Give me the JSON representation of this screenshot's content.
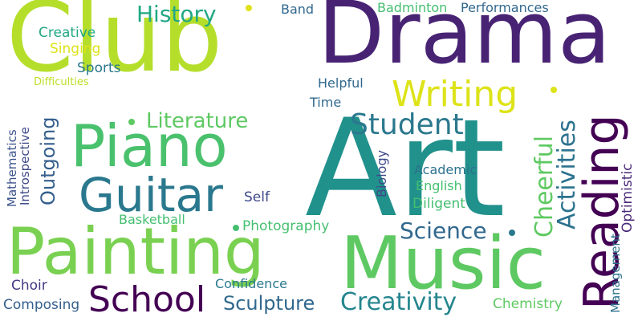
{
  "words": [
    {
      "id": "club",
      "text": "Club",
      "color": "#b5de2b"
    },
    {
      "id": "drama",
      "text": "Drama",
      "color": "#482374"
    },
    {
      "id": "art",
      "text": "Art",
      "color": "#21918c"
    },
    {
      "id": "piano",
      "text": "Piano",
      "color": "#4ac16d"
    },
    {
      "id": "guitar",
      "text": "Guitar",
      "color": "#2a788e"
    },
    {
      "id": "painting",
      "text": "Painting",
      "color": "#7ad151"
    },
    {
      "id": "music",
      "text": "Music",
      "color": "#5ec962"
    },
    {
      "id": "reading",
      "text": "Reading",
      "color": "#440154"
    },
    {
      "id": "writing",
      "text": "Writing",
      "color": "#dde318"
    },
    {
      "id": "school",
      "text": "School",
      "color": "#440154"
    },
    {
      "id": "student",
      "text": "Student",
      "color": "#2a788e"
    },
    {
      "id": "history",
      "text": "History",
      "color": "#22a884"
    },
    {
      "id": "literature",
      "text": "Literature",
      "color": "#5ec962"
    },
    {
      "id": "activities",
      "text": "Activities",
      "color": "#2c728e"
    },
    {
      "id": "cheerful",
      "text": "Cheerful",
      "color": "#5ec962"
    },
    {
      "id": "outgoing",
      "text": "Outgoing",
      "color": "#355f8d"
    },
    {
      "id": "creativity",
      "text": "Creativity",
      "color": "#25858e"
    },
    {
      "id": "science",
      "text": "Science",
      "color": "#31688e"
    },
    {
      "id": "sculpture",
      "text": "Sculpture",
      "color": "#31688e"
    },
    {
      "id": "creative",
      "text": "Creative",
      "color": "#22a884"
    },
    {
      "id": "singing",
      "text": "Singing",
      "color": "#dde318"
    },
    {
      "id": "sports",
      "text": "Sports",
      "color": "#2a788e"
    },
    {
      "id": "difficulties",
      "text": "Difficulties",
      "color": "#bddf26"
    },
    {
      "id": "band",
      "text": "Band",
      "color": "#31688e"
    },
    {
      "id": "badminton",
      "text": "Badminton",
      "color": "#44bf70"
    },
    {
      "id": "performances",
      "text": "Performances",
      "color": "#31688e"
    },
    {
      "id": "helpful",
      "text": "Helpful",
      "color": "#31688e"
    },
    {
      "id": "time",
      "text": "Time",
      "color": "#31688e"
    },
    {
      "id": "mathematics",
      "text": "Mathematics",
      "color": "#3b528b"
    },
    {
      "id": "introspective",
      "text": "Introspective",
      "color": "#3e4989"
    },
    {
      "id": "self",
      "text": "Self",
      "color": "#3e4989"
    },
    {
      "id": "biology",
      "text": "Biology",
      "color": "#3e4989"
    },
    {
      "id": "academic",
      "text": "Academic",
      "color": "#2c728e"
    },
    {
      "id": "english",
      "text": "English",
      "color": "#44bf70"
    },
    {
      "id": "diligent",
      "text": "Diligent",
      "color": "#44bf70"
    },
    {
      "id": "basketball",
      "text": "Basketball",
      "color": "#44bf70"
    },
    {
      "id": "photography",
      "text": "Photography",
      "color": "#44bf70"
    },
    {
      "id": "management",
      "text": "Management",
      "color": "#2c728e"
    },
    {
      "id": "optimistic",
      "text": "Optimistic",
      "color": "#482878"
    },
    {
      "id": "choir",
      "text": "Choir",
      "color": "#443983"
    },
    {
      "id": "composing",
      "text": "Composing",
      "color": "#355f8d"
    },
    {
      "id": "confidence",
      "text": "Confidence",
      "color": "#2a788e"
    },
    {
      "id": "chemistry",
      "text": "Chemistry",
      "color": "#5ec962"
    }
  ],
  "dots": [
    {
      "color": "#5ec962"
    },
    {
      "color": "#44bf70"
    },
    {
      "color": "#2a788e"
    },
    {
      "color": "#dde318"
    },
    {
      "color": "#dde318"
    }
  ]
}
